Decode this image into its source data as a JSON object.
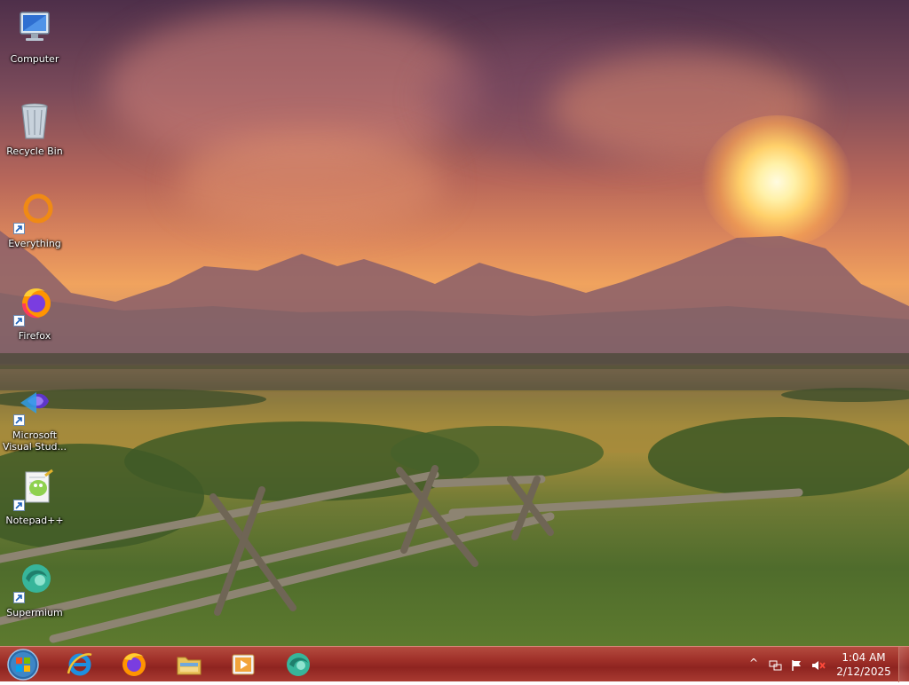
{
  "desktop": {
    "icons": [
      {
        "label": "Computer",
        "icon": "computer-icon",
        "shortcut": false
      },
      {
        "label": "Recycle Bin",
        "icon": "recycle-bin-icon",
        "shortcut": false
      },
      {
        "label": "Everything",
        "icon": "everything-icon",
        "shortcut": true
      },
      {
        "label": "Firefox",
        "icon": "firefox-icon",
        "shortcut": true
      },
      {
        "label": "Microsoft Visual Stud...",
        "icon": "visual-studio-icon",
        "shortcut": true
      },
      {
        "label": "Notepad++",
        "icon": "notepad-plus-plus-icon",
        "shortcut": true
      },
      {
        "label": "Supermium",
        "icon": "supermium-icon",
        "shortcut": true
      }
    ]
  },
  "taskbar": {
    "start_icon": "windows-start-orb-icon",
    "pinned": [
      {
        "icon": "internet-explorer-icon"
      },
      {
        "icon": "firefox-icon"
      },
      {
        "icon": "file-explorer-icon"
      },
      {
        "icon": "media-player-icon"
      },
      {
        "icon": "supermium-icon"
      }
    ],
    "tray": {
      "chevron": "^",
      "icons": [
        "network-icon",
        "action-center-flag-icon",
        "volume-muted-icon"
      ],
      "time": "1:04 AM",
      "date": "2/12/2025"
    }
  }
}
